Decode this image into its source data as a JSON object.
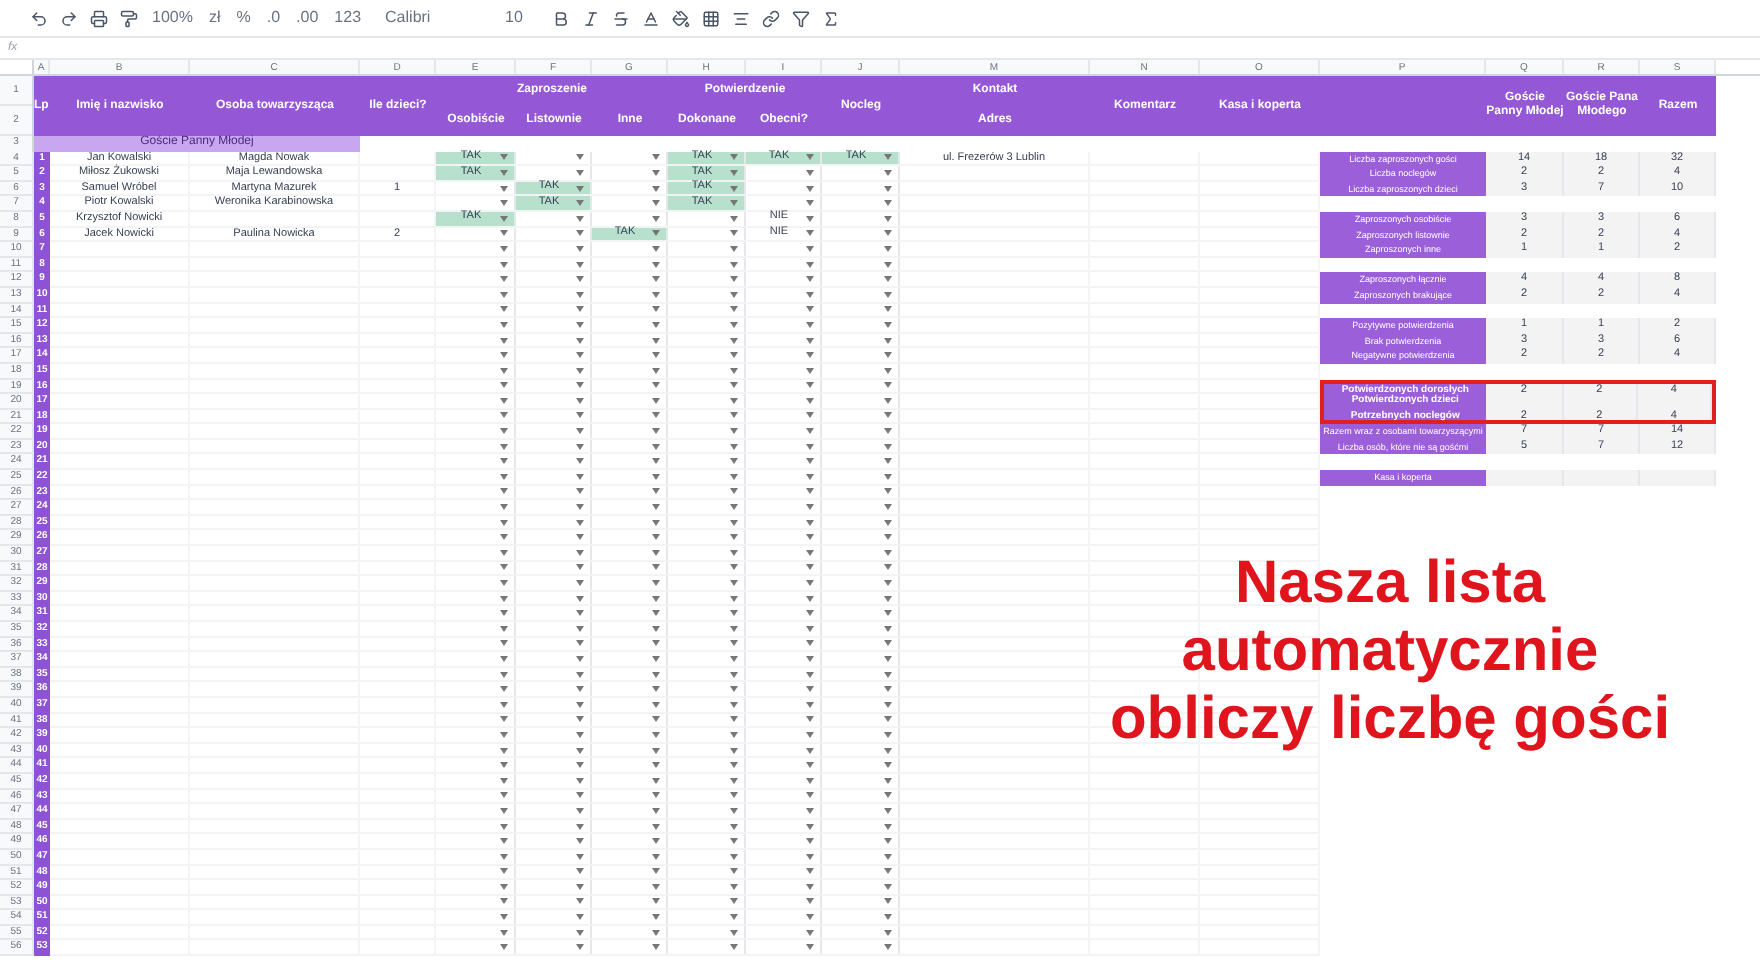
{
  "toolbar": {
    "zoom": "100%",
    "currency": "zł",
    "percent": "%",
    "decimals_less": ".0",
    "decimals_more": ".00",
    "format": "123",
    "font": "Calibri",
    "size": "10"
  },
  "formula_bar": {
    "label": "fx"
  },
  "column_letters": [
    "A",
    "B",
    "C",
    "D",
    "E",
    "F",
    "G",
    "H",
    "I",
    "J",
    "M",
    "N",
    "O",
    "P",
    "Q",
    "R",
    "S"
  ],
  "header_row_numbers": [
    "1",
    "2"
  ],
  "header": {
    "lp": "Lp",
    "name": "Imię i nazwisko",
    "companion": "Osoba towarzysząca",
    "children": "Ile dzieci?",
    "invitation": "Zaproszenie",
    "invitation_cols": [
      "Osobiście",
      "Listownie",
      "Inne"
    ],
    "confirmation": "Potwierdzenie",
    "confirmation_cols": [
      "Dokonane",
      "Obecni?"
    ],
    "lodging": "Nocleg",
    "contact": "Kontakt",
    "address": "Adres",
    "comment": "Komentarz",
    "gift": "Kasa i koperta",
    "summary_cols": [
      "Goście Panny Młodej",
      "Goście Pana Młodego",
      "Razem"
    ]
  },
  "section": {
    "row": "3",
    "label": "Goście Panny Młodej"
  },
  "rows": [
    {
      "row": "4",
      "lp": "1",
      "name": "Jan Kowalski",
      "companion": "Magda Nowak",
      "choices": {
        "in_person": {
          "value": "TAK",
          "positive": true
        },
        "done": {
          "value": "TAK",
          "positive": true
        },
        "present": {
          "value": "TAK",
          "positive": true
        },
        "lodging": {
          "value": "TAK",
          "positive": true
        }
      },
      "address": "ul. Frezerów 3 Lublin"
    },
    {
      "row": "5",
      "lp": "2",
      "name": "Miłosz Żukowski",
      "companion": "Maja Lewandowska",
      "choices": {
        "in_person": {
          "value": "TAK",
          "positive": true
        },
        "done": {
          "value": "TAK",
          "positive": true
        }
      }
    },
    {
      "row": "6",
      "lp": "3",
      "name": "Samuel Wróbel",
      "companion": "Martyna Mazurek",
      "children": "1",
      "choices": {
        "letter": {
          "value": "TAK",
          "positive": true
        },
        "done": {
          "value": "TAK",
          "positive": true
        }
      }
    },
    {
      "row": "7",
      "lp": "4",
      "name": "Piotr Kowalski",
      "companion": "Weronika Karabinowska",
      "choices": {
        "letter": {
          "value": "TAK",
          "positive": true
        },
        "done": {
          "value": "TAK",
          "positive": true
        }
      }
    },
    {
      "row": "8",
      "lp": "5",
      "name": "Krzysztof Nowicki",
      "choices": {
        "in_person": {
          "value": "TAK",
          "positive": true
        },
        "present": {
          "value": "NIE",
          "positive": false
        }
      }
    },
    {
      "row": "9",
      "lp": "6",
      "name": "Jacek Nowicki",
      "companion": "Paulina Nowicka",
      "children": "2",
      "choices": {
        "other": {
          "value": "TAK",
          "positive": true
        },
        "present": {
          "value": "NIE",
          "positive": false
        }
      }
    },
    {
      "row": "10",
      "lp": "7"
    },
    {
      "row": "11",
      "lp": "8"
    },
    {
      "row": "12",
      "lp": "9"
    },
    {
      "row": "13",
      "lp": "10"
    },
    {
      "row": "14",
      "lp": "11"
    },
    {
      "row": "15",
      "lp": "12"
    },
    {
      "row": "16",
      "lp": "13"
    },
    {
      "row": "17",
      "lp": "14"
    },
    {
      "row": "18",
      "lp": "15"
    },
    {
      "row": "19",
      "lp": "16"
    },
    {
      "row": "20",
      "lp": "17"
    },
    {
      "row": "21",
      "lp": "18"
    },
    {
      "row": "22",
      "lp": "19"
    },
    {
      "row": "23",
      "lp": "20"
    },
    {
      "row": "24",
      "lp": "21"
    },
    {
      "row": "25",
      "lp": "22"
    },
    {
      "row": "26",
      "lp": "23"
    },
    {
      "row": "27",
      "lp": "24"
    },
    {
      "row": "28",
      "lp": "25"
    },
    {
      "row": "29",
      "lp": "26"
    },
    {
      "row": "30",
      "lp": "27"
    },
    {
      "row": "31",
      "lp": "28"
    },
    {
      "row": "32",
      "lp": "29"
    },
    {
      "row": "33",
      "lp": "30"
    },
    {
      "row": "34",
      "lp": "31"
    },
    {
      "row": "35",
      "lp": "32"
    },
    {
      "row": "36",
      "lp": "33"
    },
    {
      "row": "37",
      "lp": "34"
    },
    {
      "row": "38",
      "lp": "35"
    },
    {
      "row": "39",
      "lp": "36"
    },
    {
      "row": "40",
      "lp": "37"
    },
    {
      "row": "41",
      "lp": "38"
    },
    {
      "row": "42",
      "lp": "39"
    },
    {
      "row": "43",
      "lp": "40"
    },
    {
      "row": "44",
      "lp": "41"
    },
    {
      "row": "45",
      "lp": "42"
    },
    {
      "row": "46",
      "lp": "43"
    },
    {
      "row": "47",
      "lp": "44"
    },
    {
      "row": "48",
      "lp": "45"
    },
    {
      "row": "49",
      "lp": "46"
    },
    {
      "row": "50",
      "lp": "47"
    },
    {
      "row": "51",
      "lp": "48"
    },
    {
      "row": "52",
      "lp": "49"
    },
    {
      "row": "53",
      "lp": "50"
    },
    {
      "row": "54",
      "lp": "51"
    },
    {
      "row": "55",
      "lp": "52"
    },
    {
      "row": "56",
      "lp": "53"
    }
  ],
  "summary": [
    {
      "items": [
        {
          "label": "Liczba zaproszonych gości",
          "values": [
            "14",
            "18",
            "32"
          ]
        },
        {
          "label": "Liczba noclegów",
          "values": [
            "2",
            "2",
            "4"
          ]
        },
        {
          "label": "Liczba zaproszonych dzieci",
          "values": [
            "3",
            "7",
            "10"
          ]
        }
      ]
    },
    {
      "items": [
        {
          "label": "Zaproszonych osobiście",
          "values": [
            "3",
            "3",
            "6"
          ]
        },
        {
          "label": "Zaproszonych listownie",
          "values": [
            "2",
            "2",
            "4"
          ]
        },
        {
          "label": "Zaproszonych inne",
          "values": [
            "1",
            "1",
            "2"
          ]
        }
      ]
    },
    {
      "items": [
        {
          "label": "Zaproszonych łącznie",
          "values": [
            "4",
            "4",
            "8"
          ]
        },
        {
          "label": "Zaproszonych brakujące",
          "values": [
            "2",
            "2",
            "4"
          ]
        }
      ]
    },
    {
      "items": [
        {
          "label": "Pozytywne potwierdzenia",
          "values": [
            "1",
            "1",
            "2"
          ]
        },
        {
          "label": "Brak potwierdzenia",
          "values": [
            "3",
            "3",
            "6"
          ]
        },
        {
          "label": "Negatywne potwierdzenia",
          "values": [
            "2",
            "2",
            "4"
          ]
        }
      ]
    },
    {
      "items": [
        {
          "label": "Potwierdzonych dorosłych",
          "highlighted": true,
          "values": [
            "2",
            "2",
            "4"
          ]
        },
        {
          "label": "Potwierdzonych dzieci",
          "highlighted": true
        },
        {
          "label": "Potrzebnych noclegów",
          "highlighted": true,
          "values": [
            "2",
            "2",
            "4"
          ]
        },
        {
          "label": "Razem wraz z osobami towarzyszącymi",
          "highlighted": false,
          "values": [
            "7",
            "7",
            "14"
          ]
        },
        {
          "label": "Liczba osób, które nie są gośćmi",
          "highlighted": false,
          "values": [
            "5",
            "7",
            "12"
          ]
        }
      ]
    },
    {
      "items": [
        {
          "label": "Kasa i koperta"
        }
      ]
    }
  ],
  "caption": [
    "Nasza lista",
    "automatycznie",
    "obliczy liczbę gości"
  ]
}
